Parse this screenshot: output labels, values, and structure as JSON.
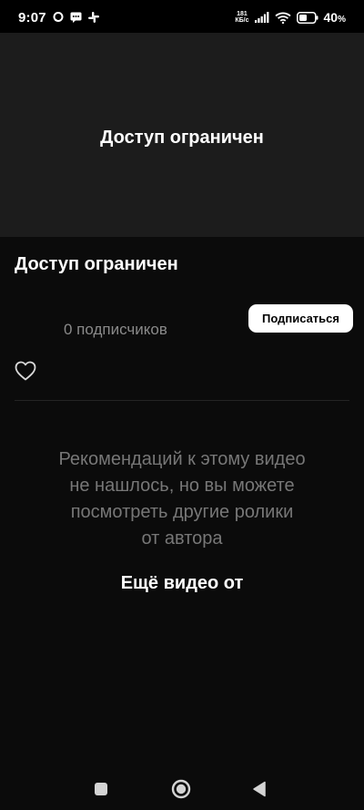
{
  "status_bar": {
    "time": "9:07",
    "net_speed_value": "181",
    "net_speed_unit": "КБ/с",
    "battery_percent": "40",
    "battery_symbol": "%"
  },
  "video": {
    "restricted_text": "Доступ ограничен"
  },
  "channel": {
    "title": "Доступ ограничен",
    "subscribers": "0 подписчиков",
    "subscribe_label": "Подписаться"
  },
  "recommendations": {
    "empty_lines": [
      "Рекомендаций к этому видео",
      "не нашлось, но вы можете",
      "посмотреть другие ролики",
      "от автора"
    ],
    "more_from_author": "Ещё видео от"
  },
  "icons": {
    "like": "heart-outline-icon",
    "nav_recents": "square-icon",
    "nav_home": "circle-icon",
    "nav_back": "triangle-back-icon"
  },
  "colors": {
    "background": "#0b0b0b",
    "video_bg": "#1c1c1c",
    "muted_text": "#777777",
    "button_bg": "#ffffff"
  }
}
